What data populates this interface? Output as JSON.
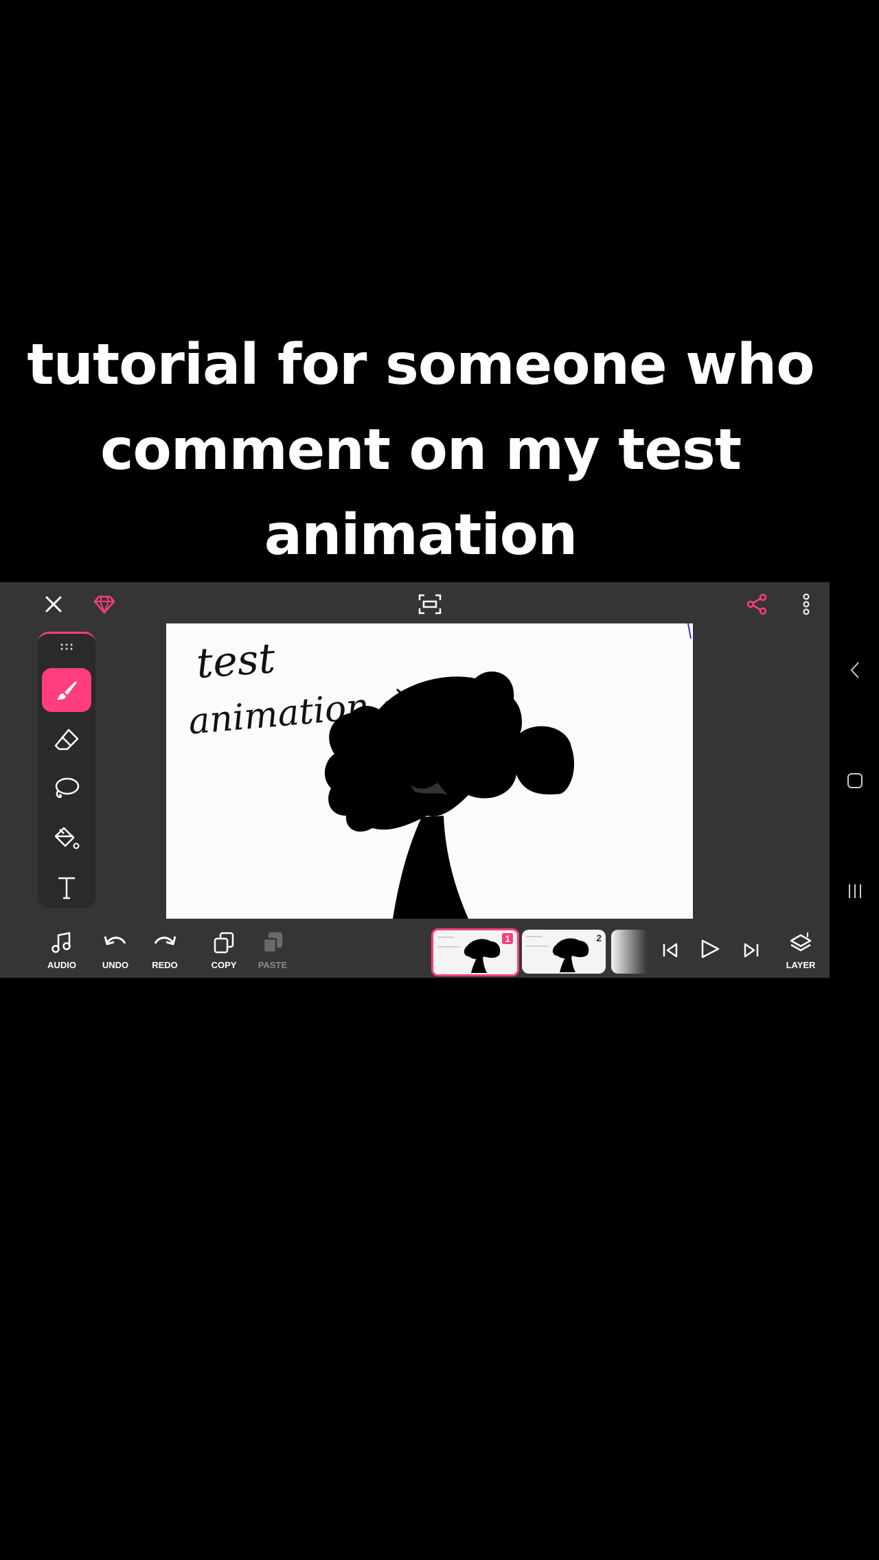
{
  "caption": {
    "line1": "tutorial for someone who",
    "line2": "comment on my test",
    "line3": "animation"
  },
  "topbar": {
    "close_icon": "close-icon",
    "premium_icon": "diamond-icon",
    "fit_icon": "fit-screen-icon",
    "share_icon": "share-icon",
    "more_icon": "more-vertical-icon"
  },
  "tools": [
    "brush-icon",
    "eraser-icon",
    "lasso-icon",
    "fill-bucket-icon",
    "text-icon"
  ],
  "canvas": {
    "text_line1": "test",
    "text_line2": "animation :)"
  },
  "bottombar": {
    "audio": "AUDIO",
    "undo": "UNDO",
    "redo": "REDO",
    "copy": "COPY",
    "paste": "PASTE",
    "layer": "LAYER"
  },
  "frames": [
    {
      "number": "1",
      "selected": true
    },
    {
      "number": "2",
      "selected": false
    }
  ],
  "colors": {
    "accent": "#ff3d7f",
    "app_bg": "#353535",
    "canvas_bg": "#fbfbfb"
  }
}
